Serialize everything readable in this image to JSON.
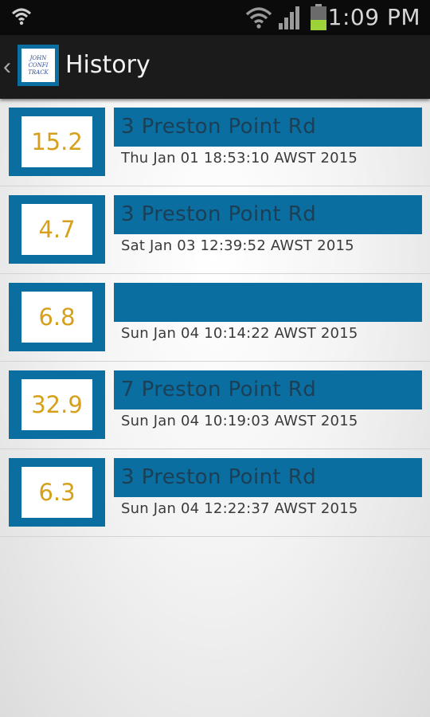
{
  "status_bar": {
    "time": "1:09 PM",
    "icons": [
      "wifi-icon",
      "signal-icon",
      "battery-icon"
    ]
  },
  "action_bar": {
    "title": "History",
    "logo_text": [
      "JOHN",
      "CONFI",
      "TRACK"
    ]
  },
  "colors": {
    "accent": "#0a6ea0",
    "value_text": "#d6a01d"
  },
  "history": [
    {
      "value": "15.2",
      "address": "3 Preston Point Rd",
      "date": "Thu Jan 01 18:53:10 AWST 2015"
    },
    {
      "value": "4.7",
      "address": "3 Preston Point Rd",
      "date": "Sat Jan 03 12:39:52 AWST 2015"
    },
    {
      "value": "6.8",
      "address": "",
      "date": "Sun Jan 04 10:14:22 AWST 2015"
    },
    {
      "value": "32.9",
      "address": "7 Preston Point Rd",
      "date": "Sun Jan 04 10:19:03 AWST 2015"
    },
    {
      "value": "6.3",
      "address": "3 Preston Point Rd",
      "date": "Sun Jan 04 12:22:37 AWST 2015"
    }
  ]
}
